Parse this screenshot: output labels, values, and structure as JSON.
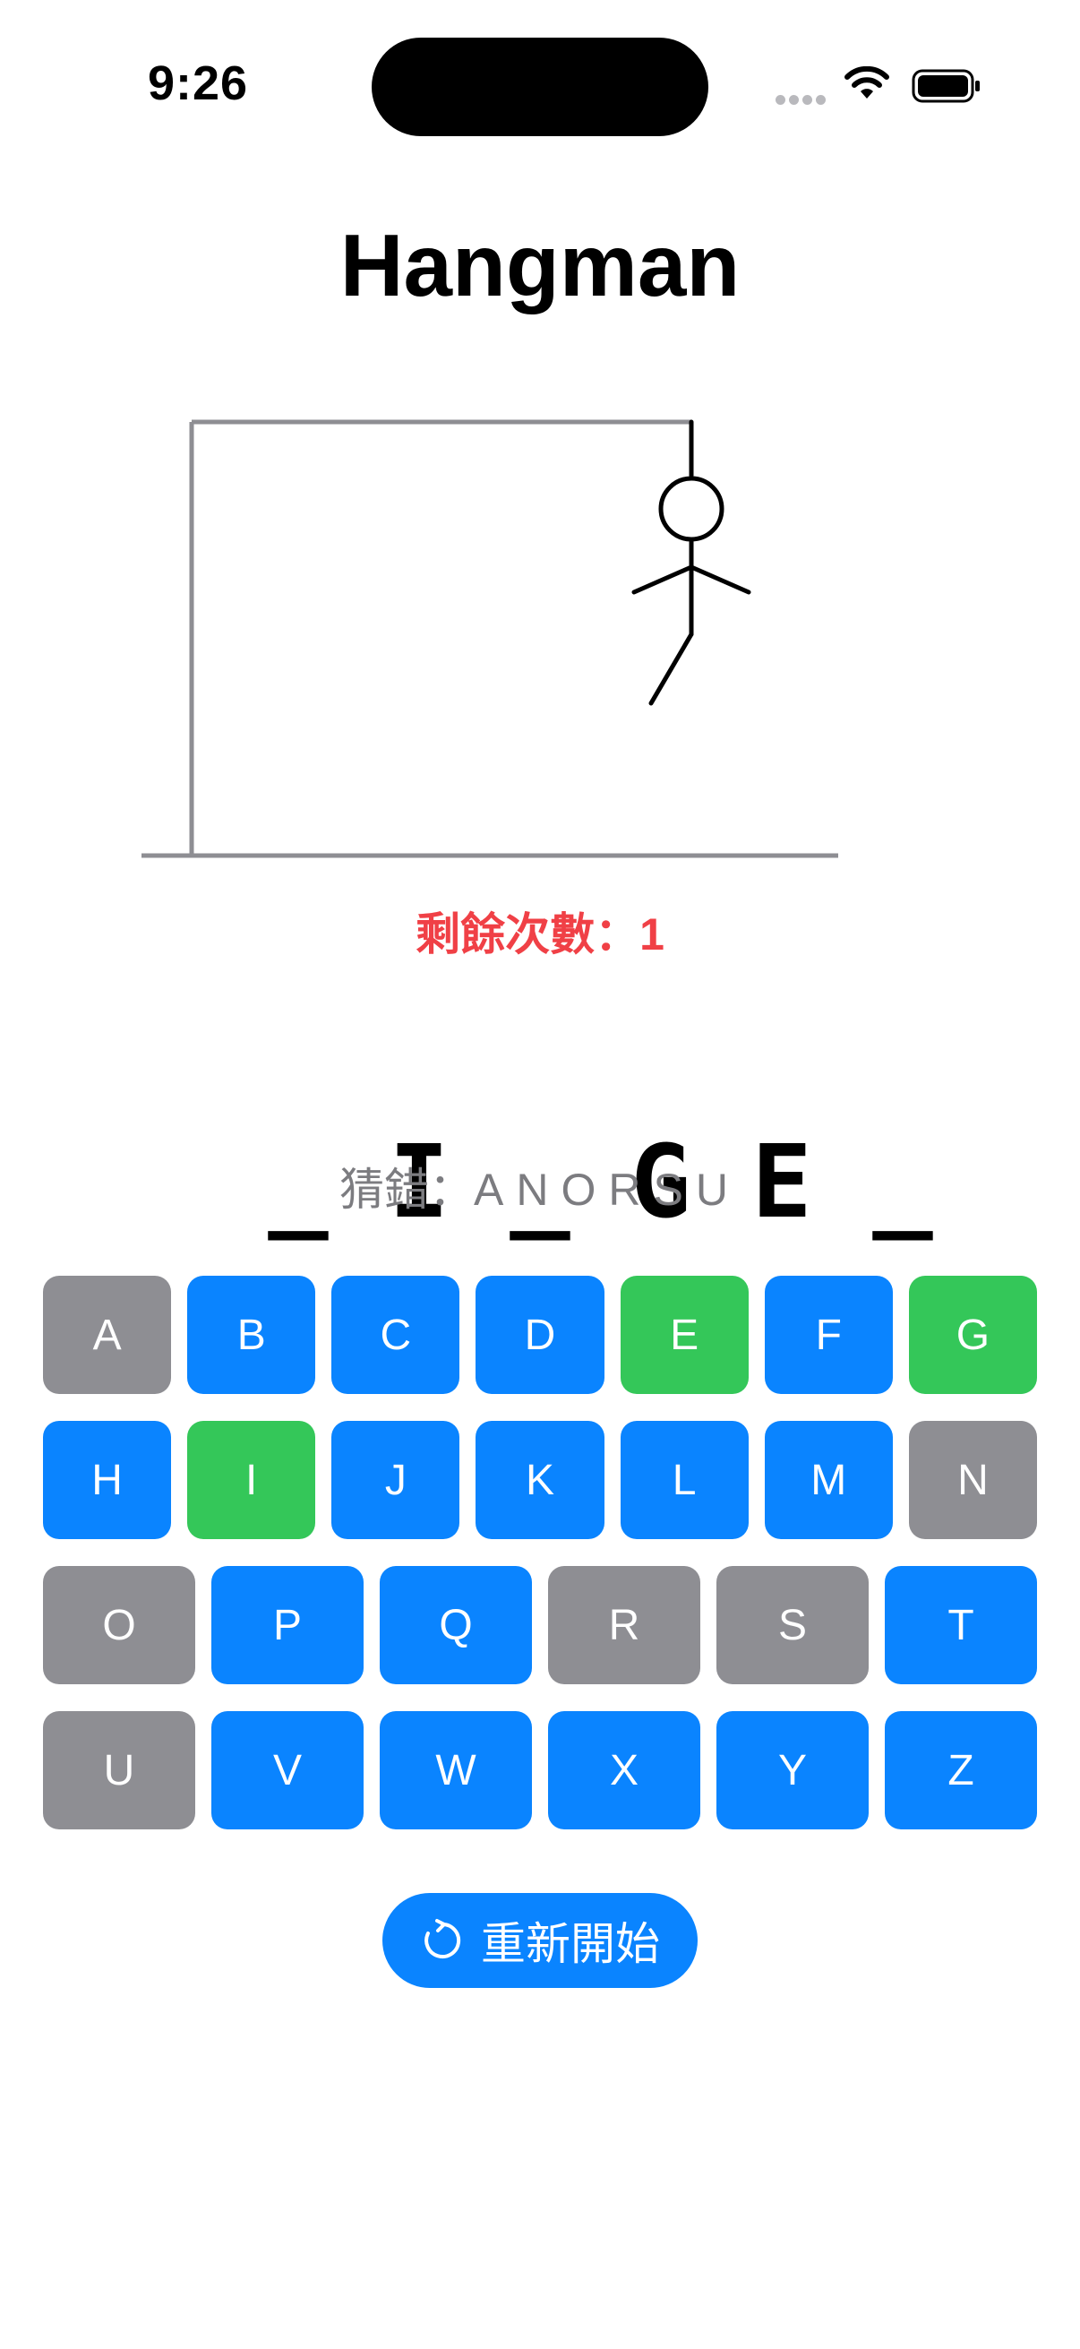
{
  "status_bar": {
    "time": "9:26"
  },
  "title": "Hangman",
  "remaining": "剩餘次數：1",
  "word": [
    "_",
    "I",
    "_",
    "G",
    "E",
    "_"
  ],
  "wrong": {
    "label": "猜錯：",
    "letters": "ANORSU"
  },
  "keyboard": {
    "rows": [
      [
        {
          "label": "A",
          "state": "gray"
        },
        {
          "label": "B",
          "state": "blue"
        },
        {
          "label": "C",
          "state": "blue"
        },
        {
          "label": "D",
          "state": "blue"
        },
        {
          "label": "E",
          "state": "green"
        },
        {
          "label": "F",
          "state": "blue"
        },
        {
          "label": "G",
          "state": "green"
        }
      ],
      [
        {
          "label": "H",
          "state": "blue"
        },
        {
          "label": "I",
          "state": "green"
        },
        {
          "label": "J",
          "state": "blue"
        },
        {
          "label": "K",
          "state": "blue"
        },
        {
          "label": "L",
          "state": "blue"
        },
        {
          "label": "M",
          "state": "blue"
        },
        {
          "label": "N",
          "state": "gray"
        }
      ],
      [
        {
          "label": "O",
          "state": "gray"
        },
        {
          "label": "P",
          "state": "blue"
        },
        {
          "label": "Q",
          "state": "blue"
        },
        {
          "label": "R",
          "state": "gray"
        },
        {
          "label": "S",
          "state": "gray"
        },
        {
          "label": "T",
          "state": "blue"
        }
      ],
      [
        {
          "label": "U",
          "state": "gray"
        },
        {
          "label": "V",
          "state": "blue"
        },
        {
          "label": "W",
          "state": "blue"
        },
        {
          "label": "X",
          "state": "blue"
        },
        {
          "label": "Y",
          "state": "blue"
        },
        {
          "label": "Z",
          "state": "blue"
        }
      ]
    ]
  },
  "restart": {
    "label": "重新開始",
    "icon": "refresh-icon"
  },
  "colors": {
    "blue": "#0a84ff",
    "green": "#34c759",
    "gray": "#8e8e93",
    "remaining": "#f04046"
  }
}
